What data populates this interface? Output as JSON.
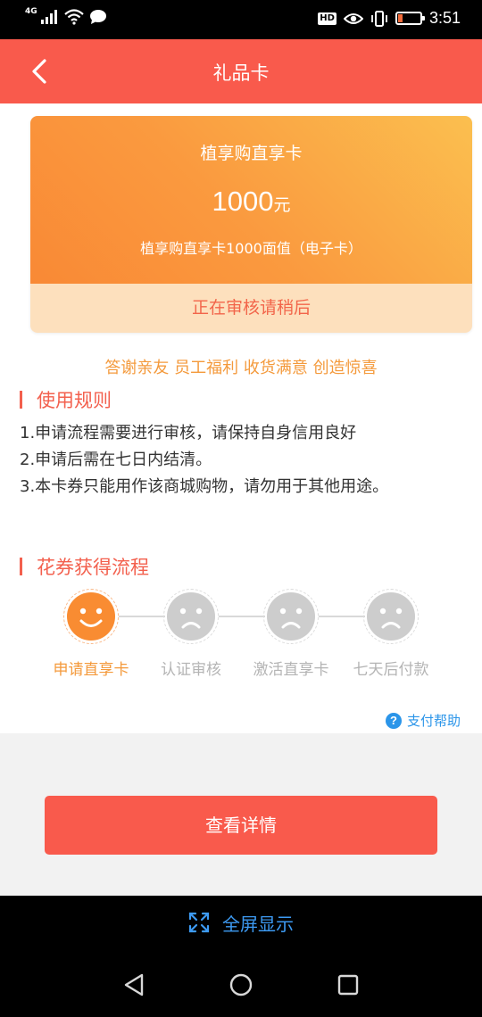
{
  "status_bar": {
    "network": "4G",
    "hd": "HD",
    "time": "3:51",
    "battery_level": 0.2
  },
  "header": {
    "title": "礼品卡"
  },
  "card": {
    "name": "植享购直享卡",
    "amount": "1000",
    "unit": "元",
    "description": "植享购直享卡1000面值（电子卡）",
    "status": "正在审核请稍后"
  },
  "slogan": "答谢亲友 员工福利 收货满意 创造惊喜",
  "rules_section": {
    "title": "使用规则",
    "items": [
      "1.申请流程需要进行审核，请保持自身信用良好",
      "2.申请后需在七日内结清。",
      "3.本卡券只能用作该商城购物，请勿用于其他用途。"
    ]
  },
  "process_section": {
    "title": "花券获得流程",
    "steps": [
      {
        "label": "申请直享卡",
        "state": "active"
      },
      {
        "label": "认证审核",
        "state": "inactive"
      },
      {
        "label": "激活直享卡",
        "state": "inactive"
      },
      {
        "label": "七天后付款",
        "state": "inactive"
      }
    ]
  },
  "help": {
    "icon": "?",
    "label": "支付帮助"
  },
  "detail_button": {
    "label": "查看详情"
  },
  "fullscreen": {
    "label": "全屏显示"
  },
  "colors": {
    "primary": "#f95a4c",
    "accent_orange": "#f49a3c",
    "link_blue": "#2b95e9"
  }
}
